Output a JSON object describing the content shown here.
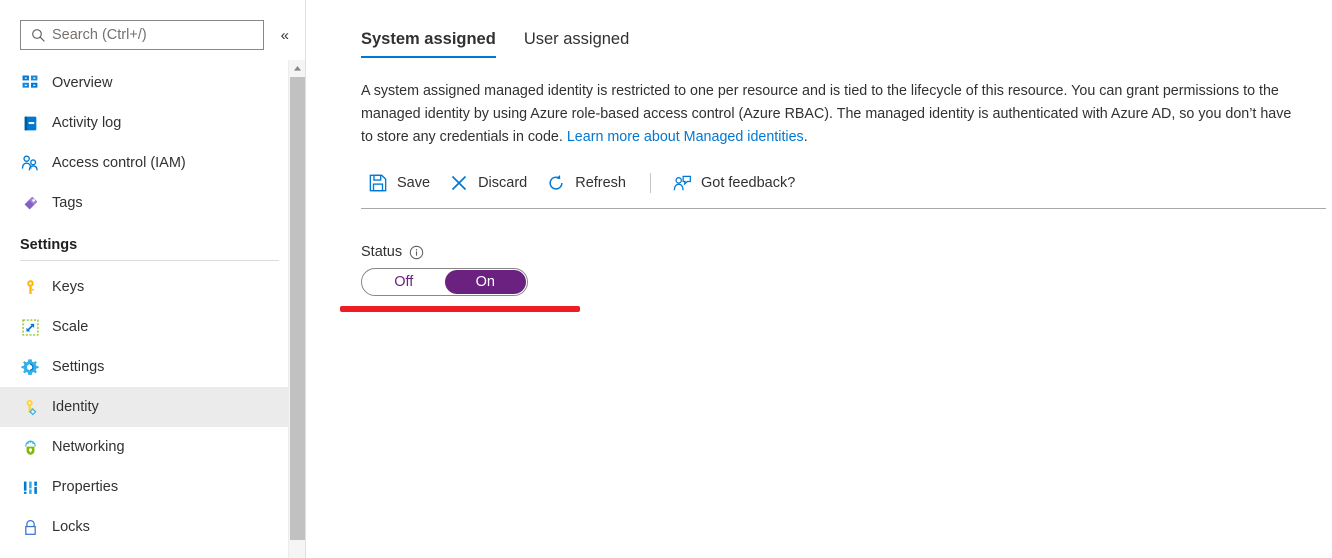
{
  "sidebar": {
    "search": {
      "placeholder": "Search (Ctrl+/)",
      "value": "",
      "icon": "search-icon"
    },
    "collapse_label": "«",
    "items": [
      {
        "label": "Overview",
        "icon": "overview-icon",
        "selected": false
      },
      {
        "label": "Activity log",
        "icon": "activity-log-icon",
        "selected": false
      },
      {
        "label": "Access control (IAM)",
        "icon": "access-control-icon",
        "selected": false
      },
      {
        "label": "Tags",
        "icon": "tags-icon",
        "selected": false
      }
    ],
    "section_title": "Settings",
    "settings_items": [
      {
        "label": "Keys",
        "icon": "key-icon",
        "selected": false
      },
      {
        "label": "Scale",
        "icon": "scale-icon",
        "selected": false
      },
      {
        "label": "Settings",
        "icon": "gear-icon",
        "selected": false
      },
      {
        "label": "Identity",
        "icon": "identity-key-icon",
        "selected": true
      },
      {
        "label": "Networking",
        "icon": "networking-icon",
        "selected": false
      },
      {
        "label": "Properties",
        "icon": "properties-icon",
        "selected": false
      },
      {
        "label": "Locks",
        "icon": "lock-icon",
        "selected": false
      }
    ],
    "scrollbar": {
      "up_arrow_icon": "chevron-up-icon"
    }
  },
  "main": {
    "tabs": [
      {
        "label": "System assigned",
        "active": true
      },
      {
        "label": "User assigned",
        "active": false
      }
    ],
    "description": {
      "text_before_link": "A system assigned managed identity is restricted to one per resource and is tied to the lifecycle of this resource. You can grant permissions to the managed identity by using Azure role-based access control (Azure RBAC). The managed identity is authenticated with Azure AD, so you don’t have to store any credentials in code. ",
      "link_text": "Learn more about Managed identities",
      "text_after_link": "."
    },
    "toolbar": {
      "save_label": "Save",
      "discard_label": "Discard",
      "refresh_label": "Refresh",
      "feedback_label": "Got feedback?"
    },
    "status": {
      "label": "Status",
      "info_icon": "info-icon",
      "options": [
        {
          "label": "Off",
          "selected": false
        },
        {
          "label": "On",
          "selected": true
        }
      ]
    }
  },
  "colors": {
    "accent_blue": "#0078d4",
    "toggle_purple": "#6b2180",
    "annotation_red": "#ee1d23",
    "selected_row_gray": "#ebebeb"
  }
}
